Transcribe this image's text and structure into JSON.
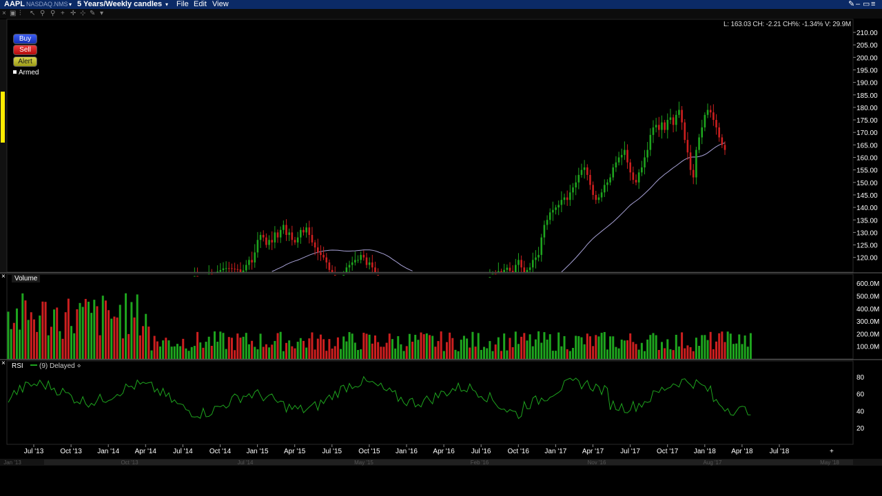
{
  "titlebar": {
    "symbol": "AAPL",
    "exchange": "NASDAQ.NMS",
    "range": "5 Years/Weekly candles",
    "menus": [
      "File",
      "Edit",
      "View"
    ],
    "dropdown_glyph": "▾"
  },
  "trade_buttons": {
    "buy": "Buy",
    "sell": "Sell",
    "alert": "Alert",
    "armed": "Armed"
  },
  "readout": "L: 163.03 CH: -2.21 CH%: -1.34% V: 29.9M",
  "colors": {
    "up": "#1ea51e",
    "down": "#cc1f1f",
    "ma": "#a9a3d8",
    "rsi": "#1ea51e",
    "grid": "#1c1c1c",
    "titlebar": "#0b2a66"
  },
  "icons": [
    "close-icon",
    "page-icon",
    "bars-icon",
    "draw-icon",
    "zoom-in-icon",
    "zoom-out-icon",
    "crosshair-icon",
    "plus-icon",
    "wrench-icon",
    "pencil-icon",
    "arrow-icon",
    "chevron-icon"
  ],
  "panels": {
    "volume_label": "Volume",
    "rsi_label": "RSI",
    "rsi_sub": "(9) Delayed"
  },
  "chart_data": {
    "type": "candlestick",
    "price_ticks": [
      "210.00",
      "205.00",
      "200.00",
      "195.00",
      "190.00",
      "185.00",
      "180.00",
      "175.00",
      "170.00",
      "165.00",
      "160.00",
      "155.00",
      "150.00",
      "145.00",
      "140.00",
      "135.00",
      "130.00",
      "125.00",
      "120.00"
    ],
    "volume_ticks": [
      "600.0M",
      "500.0M",
      "400.0M",
      "300.0M",
      "200.0M",
      "100.0M"
    ],
    "rsi_ticks": [
      "80",
      "60",
      "40",
      "20"
    ],
    "x_ticks": [
      "Jul '13",
      "Oct '13",
      "Jan '14",
      "Apr '14",
      "Jul '14",
      "Oct '14",
      "Jan '15",
      "Apr '15",
      "Jul '15",
      "Oct '15",
      "Jan '16",
      "Apr '16",
      "Jul '16",
      "Oct '16",
      "Jan '17",
      "Apr '17",
      "Jul '17",
      "Oct '17",
      "Jan '18",
      "Apr '18",
      "Jul '18"
    ],
    "nav_ticks": [
      "Jan '13",
      "Oct '13",
      "Jul '14",
      "May '15",
      "Feb '16",
      "Nov '16",
      "Aug '17",
      "May '18"
    ],
    "last_price": 163.03,
    "price_range": [
      116,
      212
    ],
    "visible_closes": {
      "Jul '13 to Jan '15": "below 120",
      "Mar '15 to Jul '15": [
        124,
        128,
        126,
        130,
        131,
        128,
        132,
        127,
        130,
        128,
        124
      ],
      "Aug '15 to Jan '16": [
        119,
        114,
        112,
        115,
        116,
        118,
        120,
        117
      ],
      "Oct '16 to Dec '16": [
        116,
        118,
        114
      ],
      "Jan '17 to Jun '17": [
        116,
        120,
        122,
        128,
        132,
        136,
        139,
        141,
        143,
        146,
        150,
        153,
        156,
        152
      ],
      "Jun '17 to Sep '17": [
        146,
        143,
        145,
        149,
        151,
        157,
        160,
        161,
        158,
        151
      ],
      "Oct '17 to Apr '18": [
        155,
        163,
        169,
        172,
        170,
        174,
        172,
        175,
        177,
        179,
        172,
        163,
        156,
        168,
        172,
        176,
        178,
        171,
        168,
        165,
        163
      ],
      "moving_average": [
        116,
        118,
        121,
        124,
        126,
        128,
        130,
        134,
        138,
        141,
        144,
        147,
        150,
        153,
        156,
        158,
        160,
        162,
        164,
        166,
        168,
        169,
        170
      ]
    },
    "volume_range_M": [
      0,
      650
    ],
    "rsi_range": [
      0,
      100
    ]
  }
}
